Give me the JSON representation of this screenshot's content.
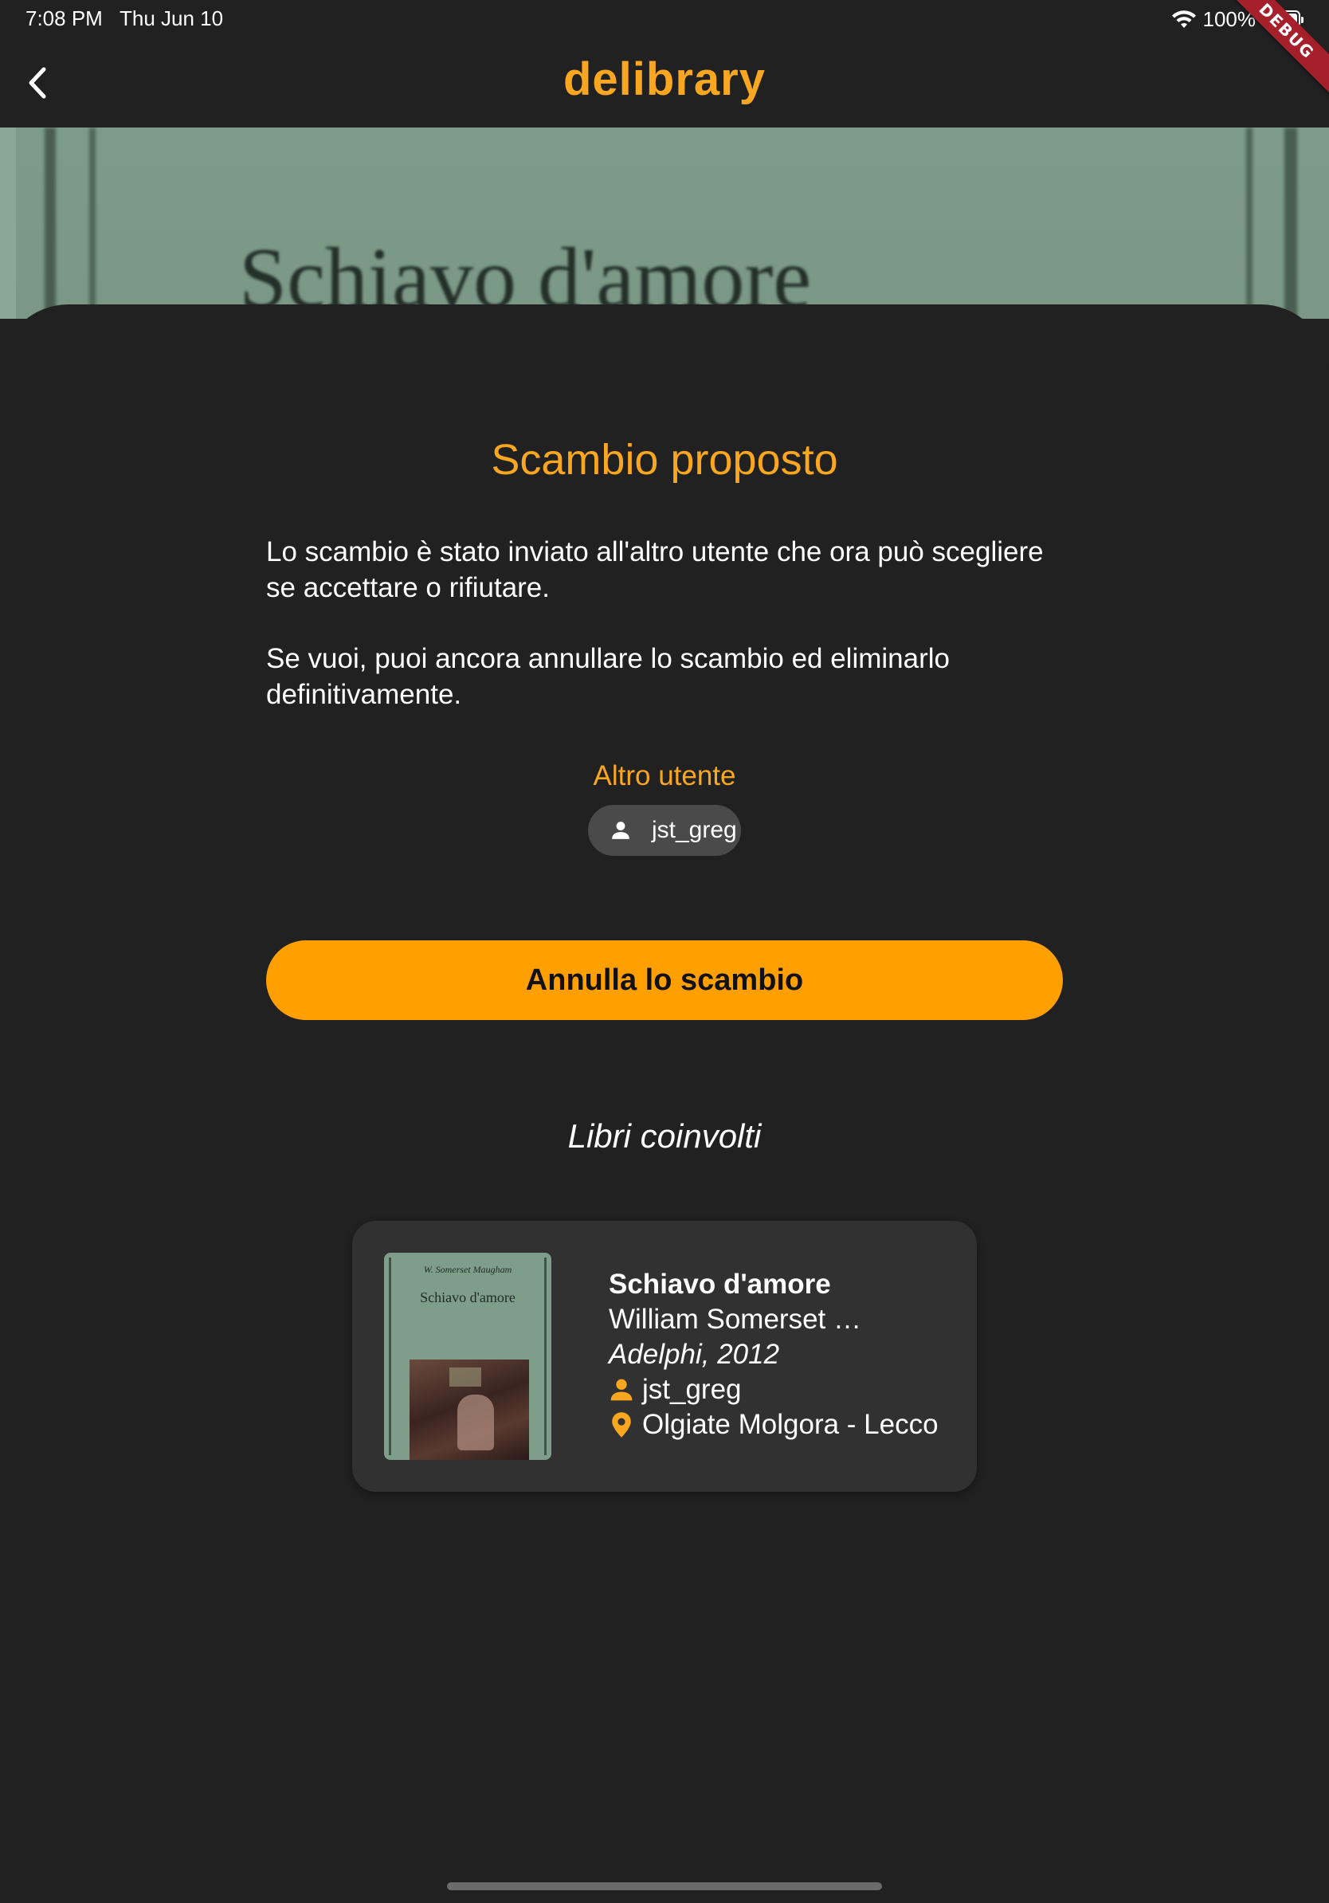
{
  "status_bar": {
    "time": "7:08 PM",
    "date": "Thu Jun 10",
    "battery": "100%",
    "debug_label": "DEBUG"
  },
  "app_bar": {
    "title": "delibrary",
    "back_icon": "chevron-left-icon"
  },
  "backdrop": {
    "cover_text": "Schiavo d'amore"
  },
  "sheet": {
    "title": "Scambio proposto",
    "message_1": "Lo scambio è stato inviato all'altro utente che ora può scegliere se accettare o rifiutare.",
    "message_2": "Se vuoi, puoi ancora annullare lo scambio ed eliminarlo definitivamente.",
    "other_user_label": "Altro utente",
    "other_user": "jst_greg",
    "cancel_button": "Annulla lo scambio",
    "books_title": "Libri coinvolti"
  },
  "book": {
    "title": "Schiavo d'amore",
    "author": "William Somerset …",
    "publisher": "Adelphi, 2012",
    "owner": "jst_greg",
    "location": "Olgiate Molgora - Lecco",
    "cover_author": "W. Somerset Maugham",
    "cover_title": "Schiavo d'amore"
  },
  "colors": {
    "accent": "#f9a720",
    "button": "#ffa000",
    "background": "#212121",
    "card": "#313131"
  }
}
